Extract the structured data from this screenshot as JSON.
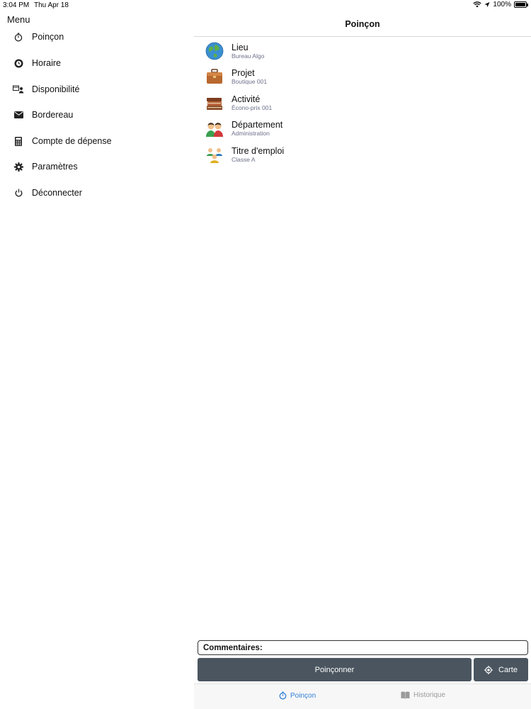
{
  "status_bar": {
    "time": "3:04 PM",
    "date": "Thu Apr 18",
    "battery": "100%",
    "icons": [
      "wifi-icon",
      "location-arrow-icon",
      "battery-icon"
    ]
  },
  "sidebar": {
    "title": "Menu",
    "items": [
      {
        "label": "Poinçon",
        "icon": "stopwatch-icon"
      },
      {
        "label": "Horaire",
        "icon": "clock-icon"
      },
      {
        "label": "Disponibilité",
        "icon": "availability-icon"
      },
      {
        "label": "Bordereau",
        "icon": "envelope-icon"
      },
      {
        "label": "Compte de dépense",
        "icon": "calculator-icon"
      },
      {
        "label": "Paramètres",
        "icon": "gear-icon"
      },
      {
        "label": "Déconnecter",
        "icon": "power-icon"
      }
    ]
  },
  "header": {
    "title": "Poinçon"
  },
  "rows": [
    {
      "title": "Lieu",
      "subtitle": "Bureau Algo",
      "icon": "globe-icon"
    },
    {
      "title": "Projet",
      "subtitle": "Boutique 001",
      "icon": "briefcase-icon"
    },
    {
      "title": "Activité",
      "subtitle": "Écono-prix 001",
      "icon": "books-icon"
    },
    {
      "title": "Département",
      "subtitle": "Administration",
      "icon": "people-icon"
    },
    {
      "title": "Titre d'emploi",
      "subtitle": "Classe A",
      "icon": "team-icon"
    }
  ],
  "comment": {
    "label": "Commentaires:"
  },
  "actions": {
    "punch_label": "Poinçonner",
    "map_label": "Carte"
  },
  "tabs": [
    {
      "label": "Poinçon",
      "icon": "stopwatch-icon",
      "active": true
    },
    {
      "label": "Historique",
      "icon": "book-icon",
      "active": false
    }
  ],
  "colors": {
    "accent": "#2f7fd6",
    "button_bg": "#4a555f",
    "subtitle": "#6b6f8a"
  }
}
